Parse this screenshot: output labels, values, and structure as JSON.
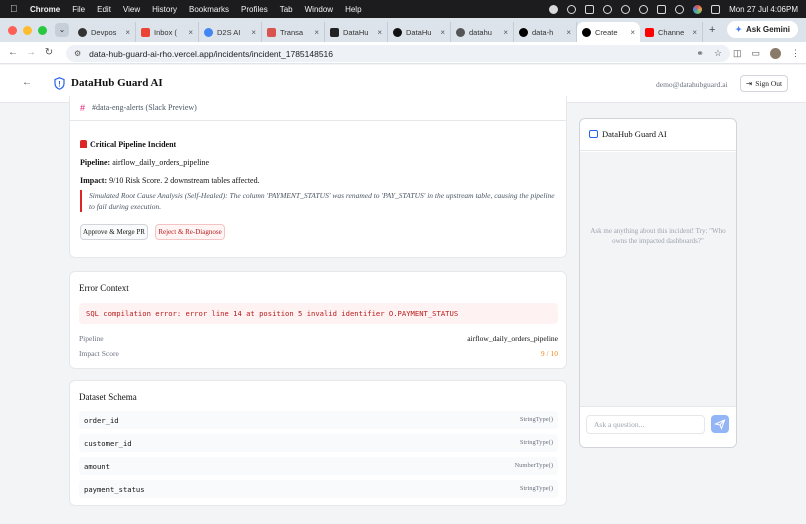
{
  "menubar": {
    "app": "Chrome",
    "items": [
      "File",
      "Edit",
      "View",
      "History",
      "Bookmarks",
      "Profiles",
      "Tab",
      "Window",
      "Help"
    ],
    "clock": "Mon 27 Jul  4:06PM"
  },
  "tabs": [
    {
      "label": "Devpos",
      "color": "#333333"
    },
    {
      "label": "Inbox (",
      "color": "#ea4335"
    },
    {
      "label": "D2S AI",
      "color": "#4285f4"
    },
    {
      "label": "Transa",
      "color": "#d9534f"
    },
    {
      "label": "DataHu",
      "color": "#222222"
    },
    {
      "label": "DataHu",
      "color": "#111111"
    },
    {
      "label": "datahu",
      "color": "#555555"
    },
    {
      "label": "data-h",
      "color": "#000000"
    },
    {
      "label": "Create",
      "color": "#000000",
      "active": true
    },
    {
      "label": "Channe",
      "color": "#ff0000"
    }
  ],
  "gemini_label": "Ask Gemini",
  "url": "data-hub-guard-ai-rho.vercel.app/incidents/incident_1785148516",
  "header": {
    "title": "DataHub Guard AI",
    "email": "demo@datahubguard.ai",
    "signout": "Sign Out"
  },
  "slack": {
    "channel": "#data-eng-alerts (Slack Preview)",
    "alert_title": "Critical Pipeline Incident",
    "pipeline_label": "Pipeline:",
    "pipeline_value": "airflow_daily_orders_pipeline",
    "impact_label": "Impact:",
    "impact_value": "9/10 Risk Score. 2 downstream tables affected.",
    "quote": "Simulated Root Cause Analysis (Self-Healed): The column 'PAYMENT_STATUS' was renamed to 'PAY_STATUS' in the upstream table, causing the pipeline to fail during execution.",
    "approve_label": "Approve & Merge PR",
    "reject_label": "Reject & Re-Diagnose"
  },
  "error_context": {
    "heading": "Error Context",
    "error": "SQL compilation error: error line 14 at position 5 invalid identifier O.PAYMENT_STATUS",
    "pipeline_label": "Pipeline",
    "pipeline_value": "airflow_daily_orders_pipeline",
    "score_label": "Impact Score",
    "score_value": "9 / 10"
  },
  "schema": {
    "heading": "Dataset Schema",
    "columns": [
      {
        "name": "order_id",
        "type": "StringType()"
      },
      {
        "name": "customer_id",
        "type": "StringType()"
      },
      {
        "name": "amount",
        "type": "NumberType()"
      },
      {
        "name": "payment_status",
        "type": "StringType()"
      }
    ]
  },
  "chat": {
    "title": "DataHub Guard AI",
    "hint": "Ask me anything about this incident! Try: \"Who owns the impacted dashboards?\"",
    "placeholder": "Ask a question..."
  }
}
